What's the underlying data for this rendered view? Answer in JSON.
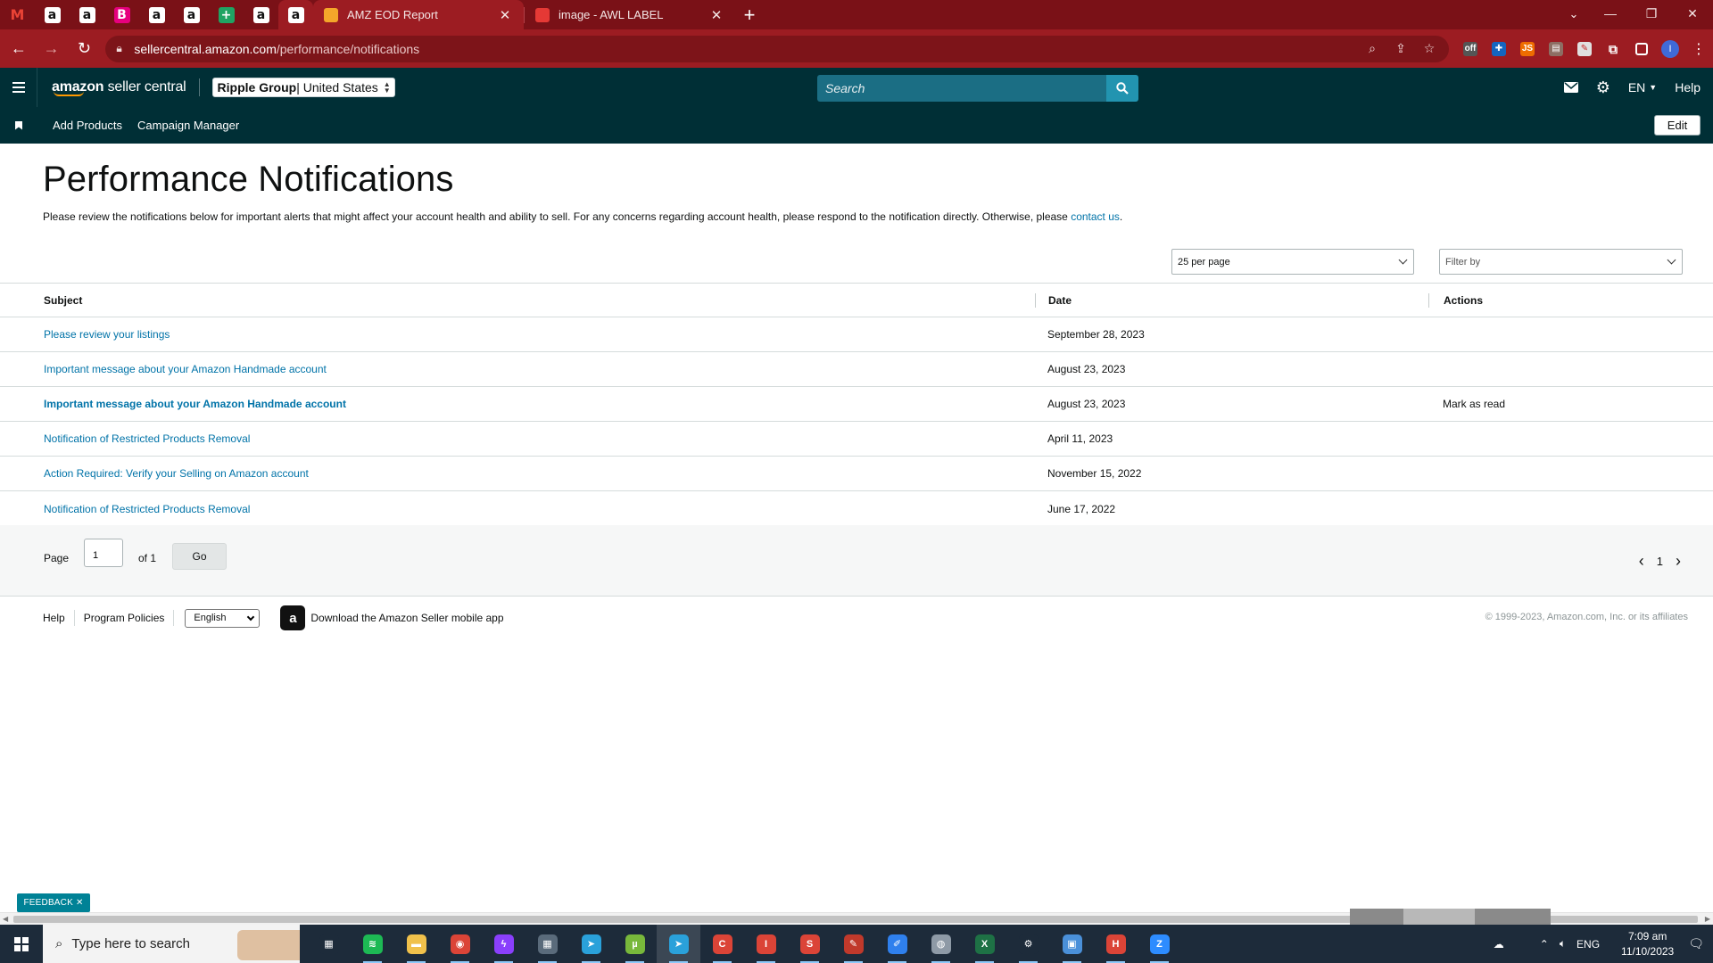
{
  "browser": {
    "pinned_tabs": [
      {
        "name": "gmail",
        "glyph": "M"
      },
      {
        "name": "amazon",
        "glyph": "a"
      },
      {
        "name": "amazon",
        "glyph": "a"
      },
      {
        "name": "b-app",
        "glyph": "B"
      },
      {
        "name": "amazon",
        "glyph": "a"
      },
      {
        "name": "amazon",
        "glyph": "a"
      },
      {
        "name": "sheets",
        "glyph": "+"
      },
      {
        "name": "amazon",
        "glyph": "a"
      },
      {
        "name": "amazon",
        "glyph": "a"
      }
    ],
    "tabs": [
      {
        "title": "AMZ EOD Report",
        "close": "✕",
        "favicon_color": "#f4a62a"
      },
      {
        "title": "image - AWL LABEL",
        "close": "✕",
        "favicon_color": "#e53935"
      }
    ],
    "new_tab": "+",
    "url_domain": "sellercentral.amazon.com",
    "url_path": "/performance/notifications",
    "profile_initial": "I"
  },
  "header": {
    "logo_bold": "amazon",
    "logo_rest": " seller central",
    "store_name": "Ripple Group",
    "marketplace": " | United States",
    "search_placeholder": "Search",
    "language": "EN",
    "help": "Help"
  },
  "subnav": {
    "links": [
      "Add Products",
      "Campaign Manager"
    ],
    "edit": "Edit"
  },
  "page": {
    "title": "Performance Notifications",
    "intro": "Please review the notifications below for important alerts that might affect your account health and ability to sell. For any concerns regarding account health, please respond to the notification directly. Otherwise, please ",
    "intro_link": "contact us",
    "intro_end": ".",
    "per_page": "25 per page",
    "filter_by": "Filter by"
  },
  "table": {
    "headers": {
      "subject": "Subject",
      "date": "Date",
      "actions": "Actions"
    },
    "rows": [
      {
        "subject": "Please review your listings",
        "date": "September 28, 2023",
        "action": "",
        "unread": false
      },
      {
        "subject": "Important message about your Amazon Handmade account",
        "date": "August 23, 2023",
        "action": "",
        "unread": false
      },
      {
        "subject": "Important message about your Amazon Handmade account",
        "date": "August 23, 2023",
        "action": "Mark as read",
        "unread": true
      },
      {
        "subject": "Notification of Restricted Products Removal",
        "date": "April 11, 2023",
        "action": "",
        "unread": false
      },
      {
        "subject": "Action Required: Verify your Selling on Amazon account",
        "date": "November 15, 2022",
        "action": "",
        "unread": false
      },
      {
        "subject": "Notification of Restricted Products Removal",
        "date": "June 17, 2022",
        "action": "",
        "unread": false
      }
    ]
  },
  "pagination": {
    "page_label": "Page",
    "page_value": "1",
    "of_label": "of 1",
    "go": "Go",
    "prev": "‹",
    "current": "1",
    "next": "›"
  },
  "footer": {
    "help": "Help",
    "program_policies": "Program Policies",
    "language": "English",
    "app_text": "Download the Amazon Seller mobile app",
    "copyright": "© 1999-2023, Amazon.com, Inc. or its affiliates"
  },
  "feedback": "FEEDBACK ✕",
  "taskbar": {
    "search_placeholder": "Type here to search",
    "apps": [
      {
        "name": "task-view",
        "color": "#1d2b3a",
        "glyph": "▦"
      },
      {
        "name": "spotify",
        "color": "#1db954",
        "glyph": "≋"
      },
      {
        "name": "file-explorer",
        "color": "#f0c14b",
        "glyph": "▬"
      },
      {
        "name": "chrome",
        "color": "#db4437",
        "glyph": "◉"
      },
      {
        "name": "messenger",
        "color": "#8a3ffc",
        "glyph": "ϟ"
      },
      {
        "name": "calculator",
        "color": "#5a6b7b",
        "glyph": "▦"
      },
      {
        "name": "telegram",
        "color": "#2aa1da",
        "glyph": "➤"
      },
      {
        "name": "utorrent",
        "color": "#78b83b",
        "glyph": "µ"
      },
      {
        "name": "telegram-active",
        "color": "#2aa1da",
        "glyph": "➤"
      },
      {
        "name": "chrome-profile-c",
        "color": "#db4437",
        "glyph": "C"
      },
      {
        "name": "chrome-profile-i",
        "color": "#db4437",
        "glyph": "I"
      },
      {
        "name": "chrome-profile-s",
        "color": "#db4437",
        "glyph": "S"
      },
      {
        "name": "tool-app",
        "color": "#c0392b",
        "glyph": "✎"
      },
      {
        "name": "paint-app",
        "color": "#2f80ed",
        "glyph": "✐"
      },
      {
        "name": "paint-palette",
        "color": "#8e9aa6",
        "glyph": "◍"
      },
      {
        "name": "excel",
        "color": "#1e7145",
        "glyph": "X"
      },
      {
        "name": "settings",
        "color": "#1d2b3a",
        "glyph": "⚙"
      },
      {
        "name": "remote-app",
        "color": "#4a90d9",
        "glyph": "▣"
      },
      {
        "name": "chrome-profile-h",
        "color": "#db4437",
        "glyph": "H"
      },
      {
        "name": "zoom",
        "color": "#2d8cff",
        "glyph": "Z"
      }
    ],
    "tray_lang": "ENG",
    "time": "7:09 am",
    "date": "11/10/2023"
  }
}
